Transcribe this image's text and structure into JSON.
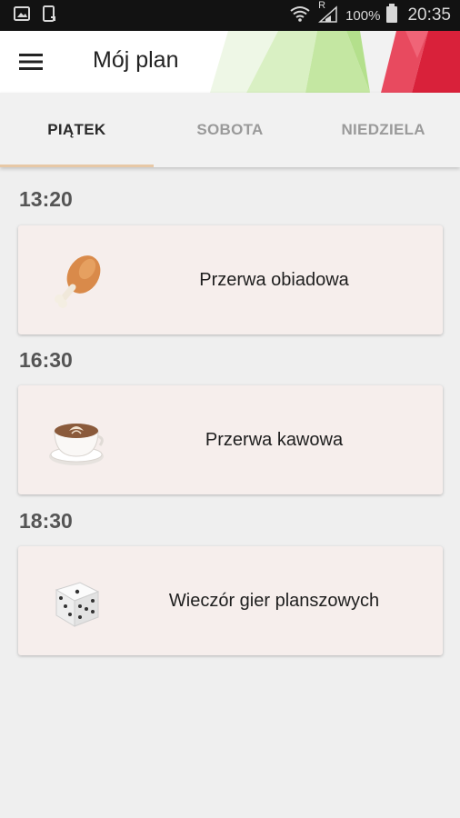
{
  "status_bar": {
    "battery_percent": "100%",
    "time": "20:35",
    "roaming_indicator": "R",
    "icons": [
      "image-icon",
      "phone-icon",
      "wifi-icon",
      "signal-icon",
      "battery-icon"
    ]
  },
  "app_bar": {
    "title": "Mój plan",
    "menu_icon": "hamburger-menu-icon"
  },
  "tabs": [
    {
      "label": "PIĄTEK",
      "active": true
    },
    {
      "label": "SOBOTA",
      "active": false
    },
    {
      "label": "NIEDZIELA",
      "active": false
    }
  ],
  "schedule": [
    {
      "time": "13:20",
      "title": "Przerwa obiadowa",
      "icon": "chicken-leg-icon"
    },
    {
      "time": "16:30",
      "title": "Przerwa kawowa",
      "icon": "coffee-cup-icon"
    },
    {
      "time": "18:30",
      "title": "Wieczór gier planszowych",
      "icon": "dice-icon"
    }
  ],
  "colors": {
    "tab_indicator": "#e7c8a6",
    "card_background": "#f6eeec",
    "page_background": "#efefef"
  }
}
